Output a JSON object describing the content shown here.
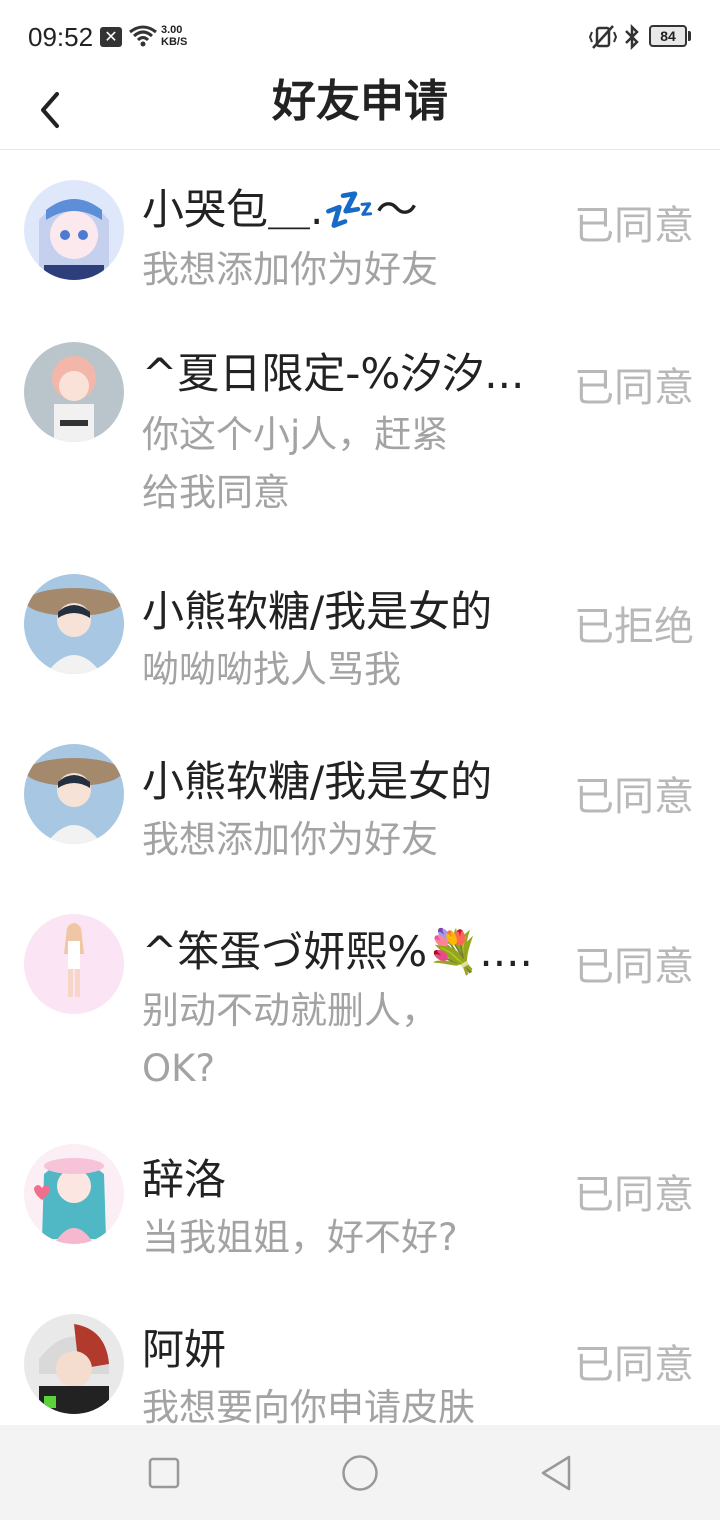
{
  "status_bar": {
    "time": "09:52",
    "notif_glyph": "✕",
    "net_speed_value": "3.00",
    "net_speed_unit": "KB/S",
    "battery": "84"
  },
  "header": {
    "title": "好友申请"
  },
  "requests": [
    {
      "name": "小哭包＿.💤～",
      "message": "我想添加你为好友",
      "status": "已同意",
      "avatar_color": "#c9d8f5"
    },
    {
      "name": "^夏日限定-%汐汐...",
      "message": "你这个小j人，赶紧给我同意",
      "status": "已同意",
      "avatar_color": "#b7c3c9"
    },
    {
      "name": "小熊软糖/我是女的",
      "message": "呦呦呦找人骂我",
      "status": "已拒绝",
      "avatar_color": "#a9c6de"
    },
    {
      "name": "小熊软糖/我是女的",
      "message": "我想添加你为好友",
      "status": "已同意",
      "avatar_color": "#a9c6de"
    },
    {
      "name": "^笨蛋づ妍熙%💐....",
      "message": "别动不动就删人，OK?",
      "status": "已同意",
      "avatar_color": "#fbe3f2"
    },
    {
      "name": "辞洛",
      "message": "当我姐姐，好不好?",
      "status": "已同意",
      "avatar_color": "#f6dbe8"
    },
    {
      "name": "阿妍",
      "message": "我想要向你申请皮肤",
      "status": "已同意",
      "avatar_color": "#7d7d7d"
    }
  ],
  "colors": {
    "title_text": "#222222",
    "secondary_text": "#a3a3a3",
    "status_text": "#b8b8b8",
    "nav_bg": "#f3f3f3"
  }
}
